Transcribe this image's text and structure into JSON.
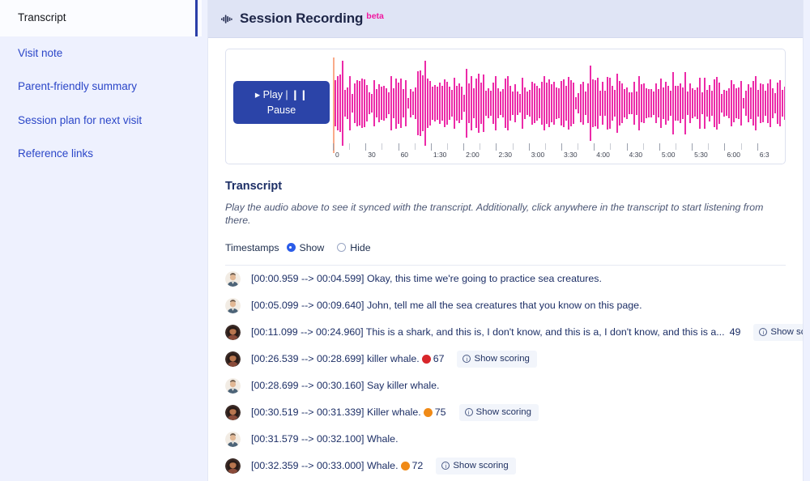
{
  "sidebar": {
    "items": [
      {
        "label": "Transcript",
        "active": true
      },
      {
        "label": "Visit note",
        "active": false
      },
      {
        "label": "Parent-friendly summary",
        "active": false
      },
      {
        "label": "Session plan for next visit",
        "active": false
      },
      {
        "label": "Reference links",
        "active": false
      }
    ]
  },
  "header": {
    "icon": "audio-waveform-icon",
    "title": "Session Recording",
    "badge": "beta",
    "badge_color": "#f0179f",
    "background": "#dfe4f5"
  },
  "player": {
    "button_label": "▸ Play | ❙❙ Pause",
    "button_color": "#2b44a8",
    "waveform_color": "#ec2aa8",
    "playhead_color": "#f9ab8a",
    "ruler_labels": [
      "0",
      "30",
      "60",
      "1:30",
      "2:00",
      "2:30",
      "3:00",
      "3:30",
      "4:00",
      "4:30",
      "5:00",
      "5:30",
      "6:00",
      "6:3"
    ]
  },
  "transcript": {
    "title": "Transcript",
    "hint": "Play the audio above to see it synced with the transcript. Additionally, click anywhere in the transcript to start listening from there.",
    "timestamps_label": "Timestamps",
    "options": [
      {
        "label": "Show",
        "selected": true
      },
      {
        "label": "Hide",
        "selected": false
      }
    ],
    "show_scoring_label": "Show scoring",
    "info_icon": "info-circle-icon",
    "lines": [
      {
        "speaker": "therapist",
        "text": "[00:00.959 --> 00:04.599] Okay, this time we're going to practice sea creatures.",
        "score": null,
        "score_color": null,
        "has_scoring": false
      },
      {
        "speaker": "therapist",
        "text": "[00:05.099 --> 00:09.640] John, tell me all the sea creatures that you know on this page.",
        "score": null,
        "score_color": null,
        "has_scoring": false
      },
      {
        "speaker": "child",
        "text": "[00:11.099 --> 00:24.960] This is a shark, and this is, I don't know, and this is a, I don't know, and this is a...",
        "score": "49",
        "score_color": "#d8262a",
        "has_scoring": true
      },
      {
        "speaker": "child",
        "text": "[00:26.539 --> 00:28.699] killer whale.",
        "score": "67",
        "score_color": "#d8262a",
        "has_scoring": true
      },
      {
        "speaker": "therapist",
        "text": "[00:28.699 --> 00:30.160] Say killer whale.",
        "score": null,
        "score_color": null,
        "has_scoring": false
      },
      {
        "speaker": "child",
        "text": "[00:30.519 --> 00:31.339] Killer whale.",
        "score": "75",
        "score_color": "#f08a16",
        "has_scoring": true
      },
      {
        "speaker": "therapist",
        "text": "[00:31.579 --> 00:32.100] Whale.",
        "score": null,
        "score_color": null,
        "has_scoring": false
      },
      {
        "speaker": "child",
        "text": "[00:32.359 --> 00:33.000] Whale.",
        "score": "72",
        "score_color": "#f08a16",
        "has_scoring": true
      }
    ]
  }
}
